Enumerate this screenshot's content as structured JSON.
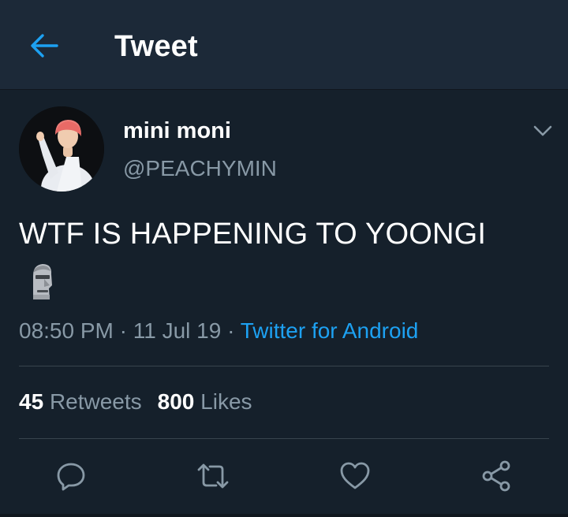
{
  "header": {
    "title": "Tweet",
    "back_icon": "arrow-left-icon",
    "accent_color": "#1da1f2"
  },
  "tweet": {
    "author": {
      "display_name": "mini moni",
      "handle": "@PEACHYMIN"
    },
    "text": "WTF IS HAPPENING TO YOONGI",
    "emoji": "moai-emoji",
    "time": "08:50 PM",
    "separator": "·",
    "date": "11 Jul 19",
    "source": "Twitter for Android",
    "retweets_count": "45",
    "retweets_label": "Retweets",
    "likes_count": "800",
    "likes_label": "Likes"
  },
  "actions": [
    {
      "icon": "reply-icon"
    },
    {
      "icon": "retweet-icon"
    },
    {
      "icon": "like-icon"
    },
    {
      "icon": "share-icon"
    }
  ],
  "colors": {
    "background": "#15202b",
    "header_bg": "#1c2938",
    "secondary_text": "#8899a6",
    "link": "#1da1f2",
    "divider": "#38444d"
  }
}
